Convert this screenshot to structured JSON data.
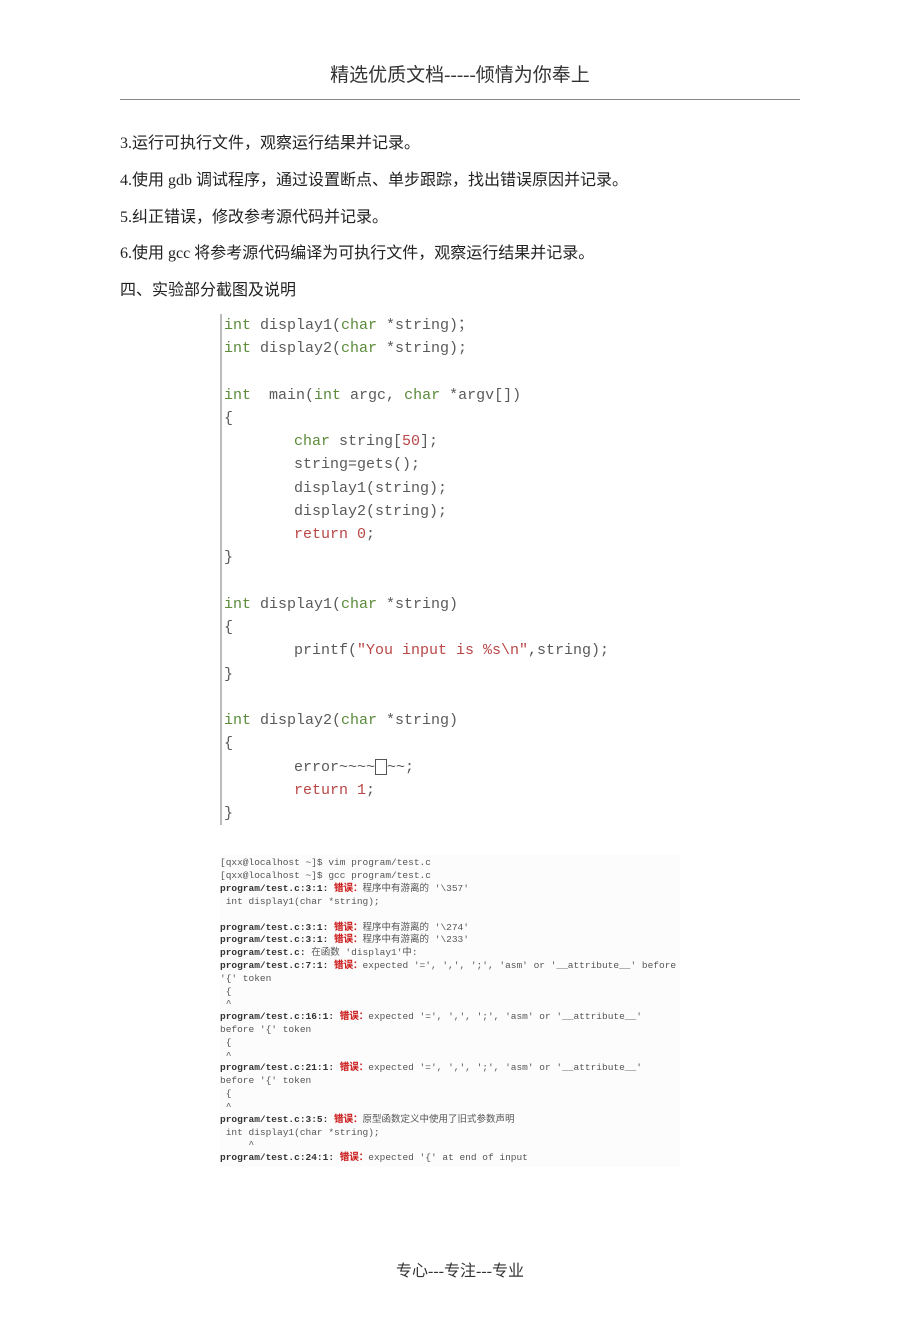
{
  "header": "精选优质文档-----倾情为你奉上",
  "paragraphs": {
    "p3": "3.运行可执行文件，观察运行结果并记录。",
    "p4": "4.使用 gdb 调试程序，通过设置断点、单步跟踪，找出错误原因并记录。",
    "p5": "5.纠正错误，修改参考源代码并记录。",
    "p6": "6.使用 gcc 将参考源代码编译为可执行文件，观察运行结果并记录。"
  },
  "section4": "四、实验部分截图及说明",
  "code": {
    "l1a": "int",
    "l1b": " display1(",
    "l1c": "char",
    "l1d": " *string)；",
    "l2a": "int",
    "l2b": " display2(",
    "l2c": "char",
    "l2d": " *string);",
    "l4a": "int",
    "l4b": "  main(",
    "l4c": "int",
    "l4d": " argc, ",
    "l4e": "char",
    "l4f": " *argv[])",
    "l5": "{",
    "l6a": "char",
    "l6b": " string[",
    "l6c": "50",
    "l6d": "];",
    "l7": "string=gets();",
    "l8": "display1(string);",
    "l9": "display2(string);",
    "l10a": "return",
    "l10b": " 0",
    "l10c": ";",
    "l11": "}",
    "l13a": "int",
    "l13b": " display1(",
    "l13c": "char",
    "l13d": " *string)",
    "l14": "{",
    "l15a": "printf(",
    "l15b": "\"You input is %s\\n\"",
    "l15c": ",string);",
    "l16": "}",
    "l18a": "int",
    "l18b": " display2(",
    "l18c": "char",
    "l18d": " *string)",
    "l19": "{",
    "l20a": "error~~~~",
    "l20b": "~~;",
    "l21a": "return",
    "l21b": " 1",
    "l21c": ";",
    "l22": "}"
  },
  "terminal": {
    "t1": "[qxx@localhost ~]$ vim program/test.c",
    "t2": "[qxx@localhost ~]$ gcc program/test.c",
    "t3a": "program/test.c:3:1: ",
    "t3err": "错误：",
    "t3b": "程序中有游离的 '\\357'",
    "t4": " int display1(char *string);",
    "t5": " ",
    "t6a": "program/test.c:3:1: ",
    "t6err": "错误：",
    "t6b": "程序中有游离的 '\\274'",
    "t7a": "program/test.c:3:1: ",
    "t7err": "错误：",
    "t7b": "程序中有游离的 '\\233'",
    "t8a": "program/test.c: ",
    "t8b": "在函数 'display1'中:",
    "t9a": "program/test.c:7:1: ",
    "t9err": "错误：",
    "t9b": "expected '=', ',', ';', 'asm' or '__attribute__' before '{' token",
    "t10": " {",
    "t11": " ^",
    "t12a": "program/test.c:16:1: ",
    "t12err": "错误：",
    "t12b": "expected '=', ',', ';', 'asm' or '__attribute__' before '{' token",
    "t13": " {",
    "t14": " ^",
    "t15a": "program/test.c:21:1: ",
    "t15err": "错误：",
    "t15b": "expected '=', ',', ';', 'asm' or '__attribute__' before '{' token",
    "t16": " {",
    "t17": " ^",
    "t18a": "program/test.c:3:5: ",
    "t18err": "错误：",
    "t18b": "原型函数定义中使用了旧式参数声明",
    "t19": " int display1(char *string);",
    "t20": "     ^",
    "t21a": "program/test.c:24:1: ",
    "t21err": "错误：",
    "t21b": "expected '{' at end of input"
  },
  "footer": "专心---专注---专业"
}
